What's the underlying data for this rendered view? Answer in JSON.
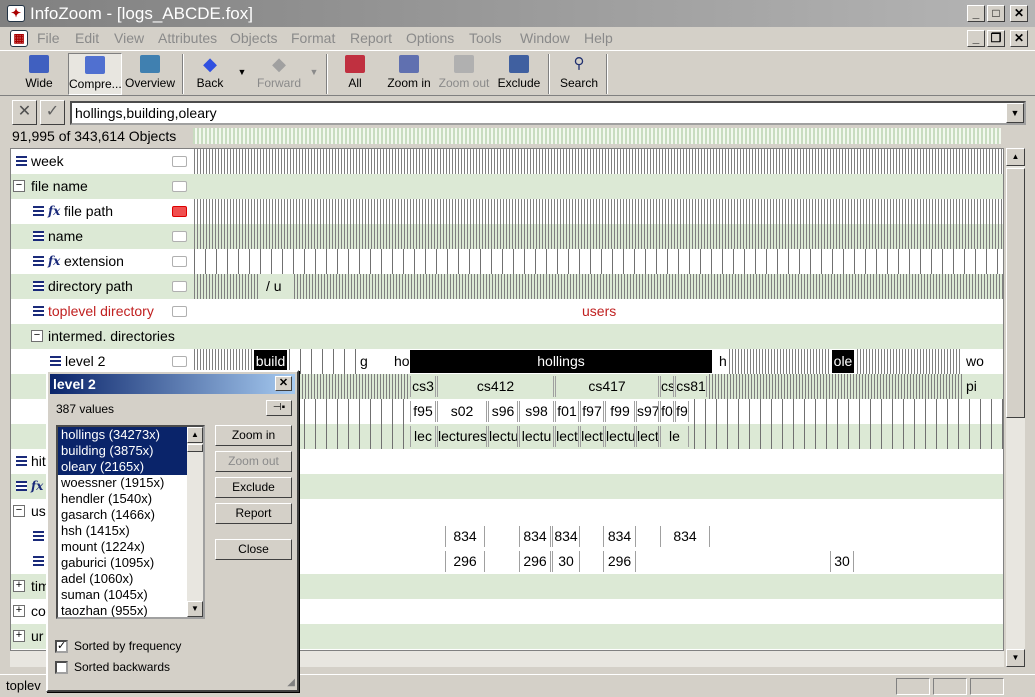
{
  "window": {
    "title": "InfoZoom - [logs_ABCDE.fox]"
  },
  "menu": [
    "File",
    "Edit",
    "View",
    "Attributes",
    "Objects",
    "Format",
    "Report",
    "Options",
    "Tools",
    "Window",
    "Help"
  ],
  "toolbar": {
    "wide": "Wide",
    "compressed": "Compre...",
    "overview": "Overview",
    "back": "Back",
    "forward": "Forward",
    "all": "All",
    "zoom_in": "Zoom in",
    "zoom_out": "Zoom out",
    "exclude": "Exclude",
    "search": "Search"
  },
  "filter": {
    "value": "hollings,building,oleary"
  },
  "object_count": "91,995 of 343,614 Objects",
  "attributes": {
    "week": "week",
    "file_name": "file name",
    "file_path": "file path",
    "name": "name",
    "extension": "extension",
    "directory_path": "directory path",
    "toplevel": "toplevel directory",
    "intermed": "intermed. directories",
    "level2": "level 2",
    "hit": "hit",
    "us": "us",
    "tim": "tim",
    "co": "co",
    "ur": "ur"
  },
  "row_values": {
    "dirpath": "/ u",
    "toplevel": "users",
    "level2_build": "build",
    "level2_g": "g",
    "level2_ho": "ho",
    "level2_hollings": "hollings",
    "level2_h": "h",
    "level2_ole": "ole",
    "level2_wo": "wo",
    "level3": [
      "cs3",
      "cs412",
      "cs417",
      "cs",
      "cs81",
      "pi"
    ],
    "level4": [
      "f95",
      "s02",
      "s96",
      "s98",
      "f01",
      "f97",
      "f99",
      "s97",
      "f0",
      "f9"
    ],
    "level5": [
      "lec",
      "lectures",
      "lectu",
      "lectu",
      "lect",
      "lect",
      "lectu",
      "lect",
      "le"
    ],
    "num1": [
      "834",
      "834",
      "834",
      "834",
      "834"
    ],
    "num2": [
      "296",
      "296",
      "30",
      "296",
      "30"
    ]
  },
  "status": {
    "text": "toplev"
  },
  "dialog": {
    "title": "level 2",
    "values_count": "387 values",
    "items": [
      "hollings   (34273x)",
      "building   (3875x)",
      "oleary   (2165x)",
      "woessner   (1915x)",
      "hendler   (1540x)",
      "gasarch   (1466x)",
      "hsh   (1415x)",
      "mount   (1224x)",
      "gaburici   (1095x)",
      "adel   (1060x)",
      "suman   (1045x)",
      "taozhan   (955x)"
    ],
    "selected_count": 3,
    "buttons": {
      "zoom_in": "Zoom in",
      "zoom_out": "Zoom out",
      "exclude": "Exclude",
      "report": "Report",
      "close": "Close"
    },
    "sorted_freq": "Sorted by frequency",
    "sorted_back": "Sorted backwards"
  }
}
